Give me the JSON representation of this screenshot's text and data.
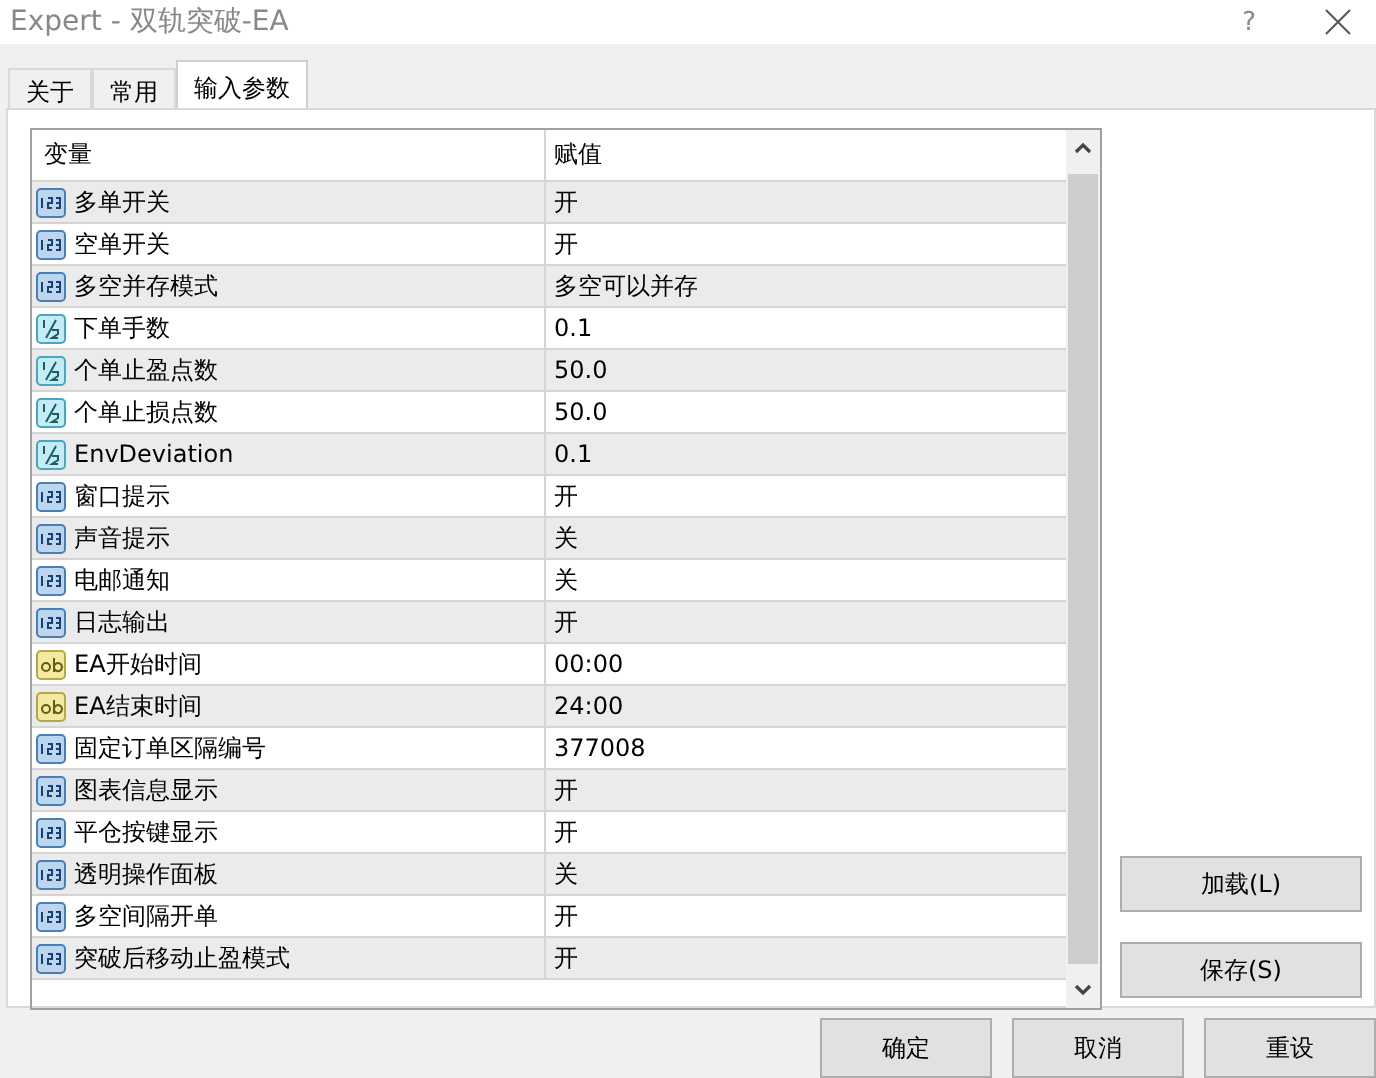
{
  "window": {
    "title": "Expert - 双轨突破-EA",
    "help": "?"
  },
  "tabs": [
    {
      "label": "关于",
      "selected": false
    },
    {
      "label": "常用",
      "selected": false
    },
    {
      "label": "输入参数",
      "selected": true
    }
  ],
  "table": {
    "columns": [
      "变量",
      "赋值"
    ],
    "rows": [
      {
        "kind": "int",
        "name": "多单开关",
        "value": "开"
      },
      {
        "kind": "int",
        "name": "空单开关",
        "value": "开"
      },
      {
        "kind": "int",
        "name": "多空并存模式",
        "value": "多空可以并存"
      },
      {
        "kind": "double",
        "name": "下单手数",
        "value": "0.1"
      },
      {
        "kind": "double",
        "name": "个单止盈点数",
        "value": "50.0"
      },
      {
        "kind": "double",
        "name": "个单止损点数",
        "value": "50.0"
      },
      {
        "kind": "double",
        "name": "EnvDeviation",
        "value": "0.1"
      },
      {
        "kind": "int",
        "name": "窗口提示",
        "value": "开"
      },
      {
        "kind": "int",
        "name": "声音提示",
        "value": "关"
      },
      {
        "kind": "int",
        "name": "电邮通知",
        "value": "关"
      },
      {
        "kind": "int",
        "name": "日志输出",
        "value": "开"
      },
      {
        "kind": "string",
        "name": "EA开始时间",
        "value": "00:00"
      },
      {
        "kind": "string",
        "name": "EA结束时间",
        "value": "24:00"
      },
      {
        "kind": "int",
        "name": "固定订单区隔编号",
        "value": "377008"
      },
      {
        "kind": "int",
        "name": "图表信息显示",
        "value": "开"
      },
      {
        "kind": "int",
        "name": "平仓按键显示",
        "value": "开"
      },
      {
        "kind": "int",
        "name": "透明操作面板",
        "value": "关"
      },
      {
        "kind": "int",
        "name": "多空间隔开单",
        "value": "开"
      },
      {
        "kind": "int",
        "name": "突破后移动止盈模式",
        "value": "开"
      }
    ]
  },
  "side_buttons": [
    "加载(L)",
    "保存(S)"
  ],
  "buttons": [
    "确定",
    "取消",
    "重设"
  ]
}
